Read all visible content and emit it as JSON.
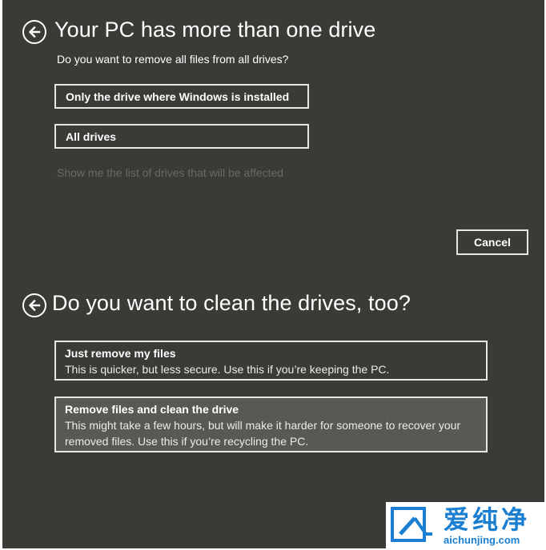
{
  "section1": {
    "title": "Your PC has more than one drive",
    "question": "Do you want to remove all files from all drives?",
    "option_windows_drive": "Only the drive where Windows is installed",
    "option_all_drives": "All drives",
    "show_drives_link": "Show me the list of drives that will be affected",
    "cancel_label": "Cancel"
  },
  "section2": {
    "title": "Do you want to clean the drives, too?",
    "options": [
      {
        "title": "Just remove my files",
        "description": "This is quicker, but less secure. Use this if you’re keeping the PC."
      },
      {
        "title": "Remove files and clean the drive",
        "description": "This might take a few hours, but will make it harder for someone to recover your removed files. Use this if you’re recycling the PC."
      }
    ]
  },
  "watermark": {
    "brand_cn": "爱纯净",
    "url": "aichunjing.com"
  },
  "icons": {
    "back": "back-arrow-icon",
    "watermark_logo": "watermark-logo-icon"
  },
  "colors": {
    "background": "#3b3a36",
    "selected_option": "#5a5854",
    "border": "#e6e6e6",
    "link_disabled": "#6a6964",
    "watermark_blue": "#1a7fd0"
  }
}
